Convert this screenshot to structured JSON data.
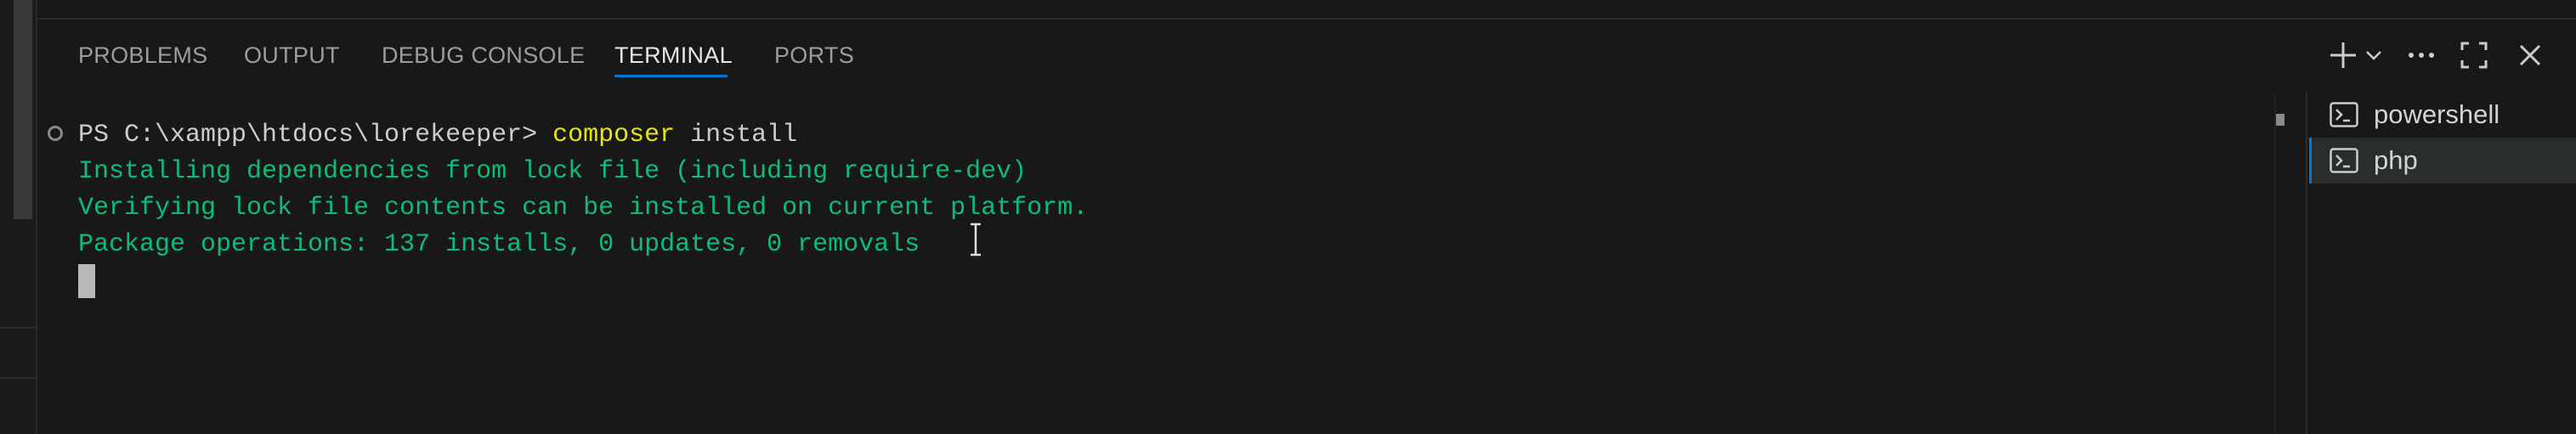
{
  "panel": {
    "tabs": [
      {
        "label": "PROBLEMS",
        "active": false
      },
      {
        "label": "OUTPUT",
        "active": false
      },
      {
        "label": "DEBUG CONSOLE",
        "active": false
      },
      {
        "label": "TERMINAL",
        "active": true
      },
      {
        "label": "PORTS",
        "active": false
      }
    ],
    "actions": [
      "plus-icon",
      "chevron-down-icon",
      "more-icon",
      "maximize-icon",
      "close-icon"
    ]
  },
  "terminal": {
    "prompt": "PS C:\\xampp\\htdocs\\lorekeeper>",
    "command": "composer",
    "argument": "install",
    "output": [
      "Installing dependencies from lock file (including require-dev)",
      "Verifying lock file contents can be installed on current platform.",
      "Package operations: 137 installs, 0 updates, 0 removals"
    ]
  },
  "terminal_list": [
    {
      "label": "powershell",
      "icon": "terminal-icon",
      "selected": false
    },
    {
      "label": "php",
      "icon": "terminal-icon",
      "selected": true
    }
  ],
  "colors": {
    "background": "#181818",
    "accent": "#0078d4",
    "command": "#e5e510",
    "output": "#0dbc79"
  }
}
